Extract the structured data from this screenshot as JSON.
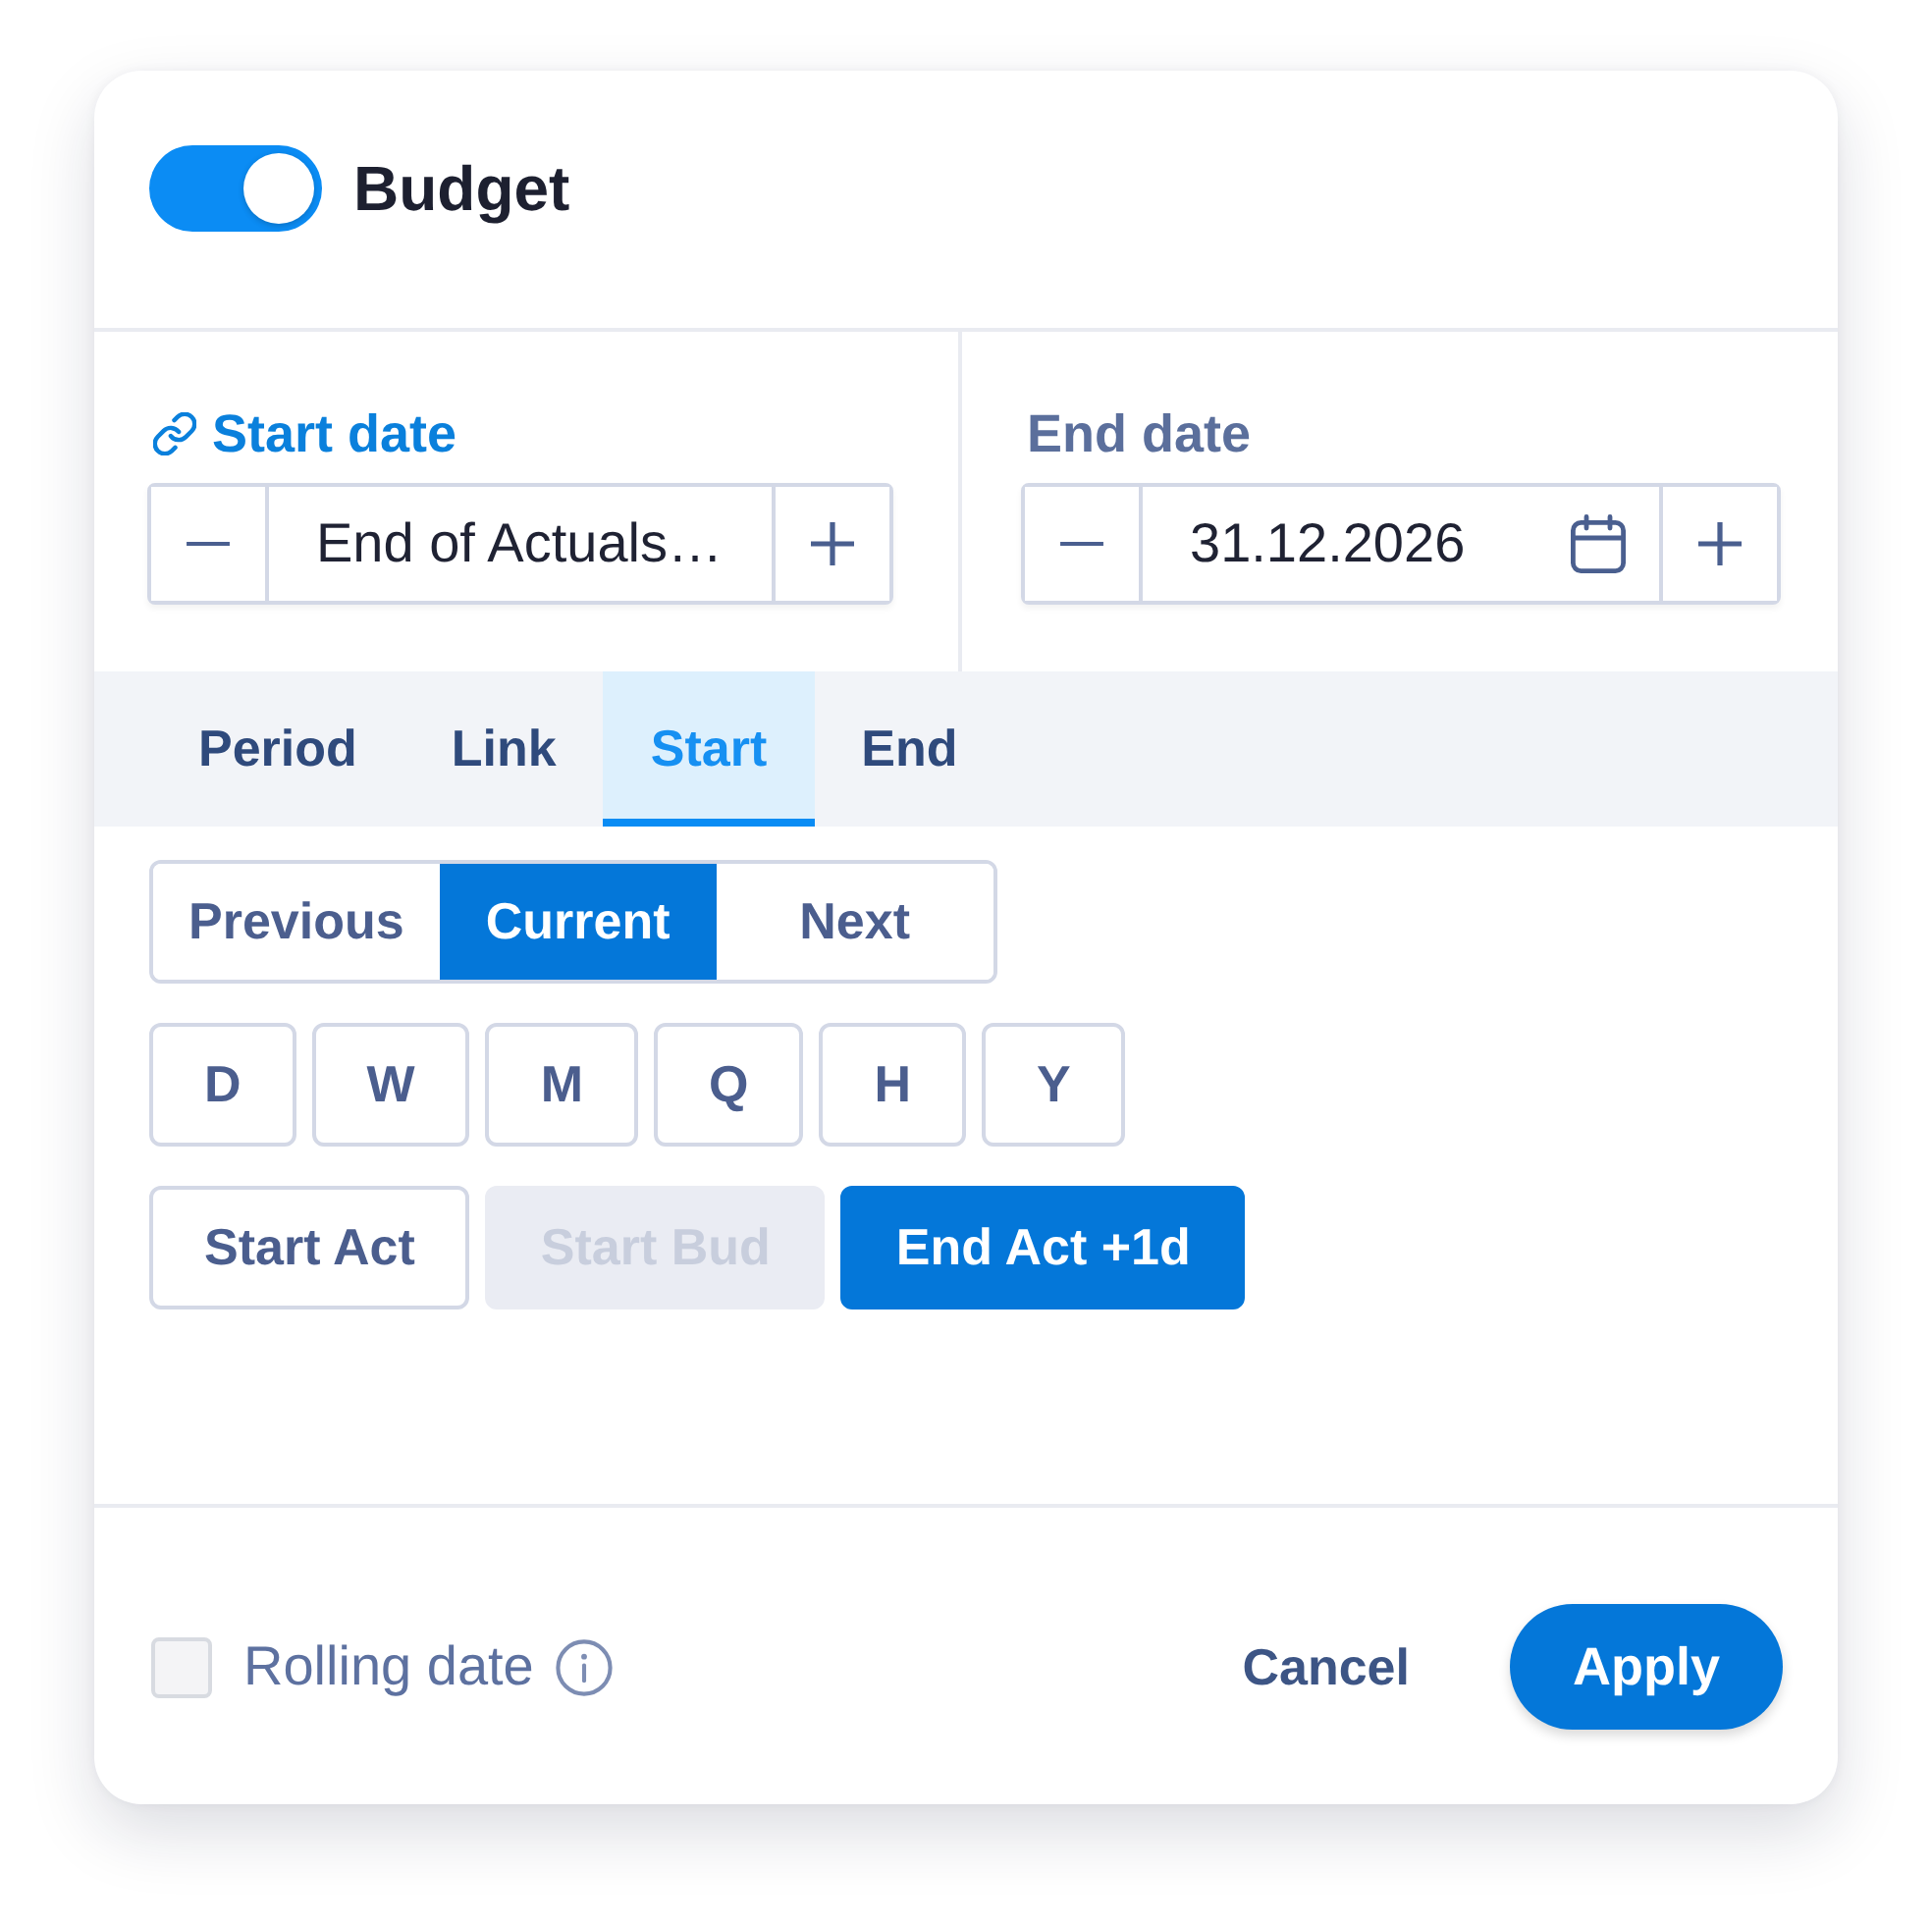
{
  "header": {
    "toggle": {
      "on": true
    },
    "title": "Budget"
  },
  "dates": [
    {
      "kind": "linked",
      "label": "Start date",
      "selected": true,
      "value": "End of Actuals…"
    },
    {
      "kind": "fixed",
      "label": "End date",
      "selected": false,
      "value": "31.12.2026"
    }
  ],
  "tabs": [
    {
      "label": "Period",
      "selected": false
    },
    {
      "label": "Link",
      "selected": false
    },
    {
      "label": "Start",
      "selected": true
    },
    {
      "label": "End",
      "selected": false
    }
  ],
  "anchor": [
    {
      "label": "Previous",
      "selected": false
    },
    {
      "label": "Current",
      "selected": true
    },
    {
      "label": "Next",
      "selected": false
    }
  ],
  "units": [
    {
      "label": "D",
      "selected": false
    },
    {
      "label": "W",
      "selected": false
    },
    {
      "label": "M",
      "selected": false
    },
    {
      "label": "Q",
      "selected": false
    },
    {
      "label": "H",
      "selected": false
    },
    {
      "label": "Y",
      "selected": false
    }
  ],
  "presets": [
    {
      "label": "Start Act",
      "selected": false,
      "disabled": false
    },
    {
      "label": "Start Bud",
      "selected": false,
      "disabled": true
    },
    {
      "label": "End Act +1d",
      "selected": true,
      "disabled": false
    }
  ],
  "footer": {
    "rolling_date": {
      "label": "Rolling date",
      "checked": false
    },
    "cancel": "Cancel",
    "apply": "Apply"
  }
}
